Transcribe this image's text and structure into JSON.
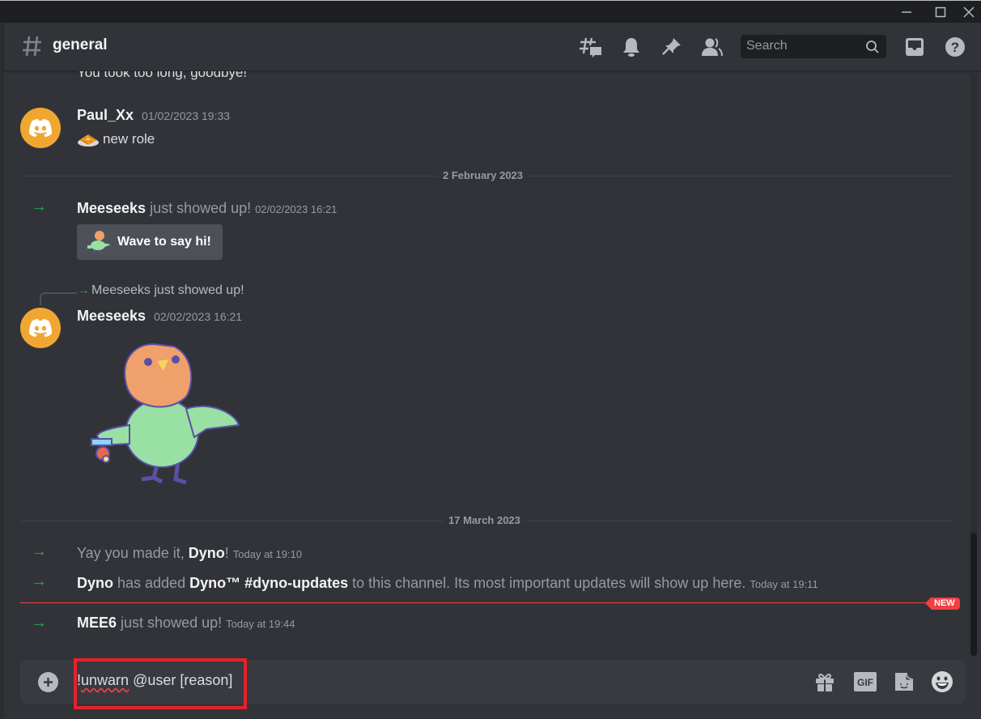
{
  "window": {
    "controls": [
      "minimize",
      "maximize",
      "close"
    ]
  },
  "header": {
    "channel_name": "general",
    "icons": [
      "threads-icon",
      "notification-bell-icon",
      "pinned-messages-icon",
      "member-list-icon",
      "inbox-icon",
      "help-icon"
    ],
    "search": {
      "placeholder": "Search"
    }
  },
  "messages": {
    "partial_top": "You took too long, goodbye!",
    "paul": {
      "username": "Paul_Xx",
      "timestamp": "01/02/2023 19:33",
      "text": "new role",
      "emoji": "waffle"
    },
    "divider_1": "2 February 2023",
    "meeseeks_join": {
      "username": "Meeseeks",
      "text": "just showed up!",
      "timestamp": "02/02/2023 16:21",
      "wave_button": "Wave to say hi!"
    },
    "meeseeks_reply": {
      "reply_preview": "Meeseeks just showed up!",
      "username": "Meeseeks",
      "timestamp": "02/02/2023 16:21",
      "sticker": "parrot-wave-sticker"
    },
    "divider_2": "17 March 2023",
    "dyno_welcome": {
      "prefix": "Yay you made it, ",
      "username": "Dyno",
      "suffix": "!",
      "timestamp": "Today at 19:10"
    },
    "dyno_follow": {
      "username": "Dyno",
      "text_1": " has added ",
      "channel": "Dyno™ #dyno-updates",
      "text_2": " to this channel. Its most important updates will show up here.",
      "timestamp": "Today at 19:11"
    },
    "new_badge": "NEW",
    "mee6_join": {
      "username": "MEE6",
      "text": "just showed up!",
      "timestamp": "Today at 19:44"
    }
  },
  "composer": {
    "value_prefix": "!",
    "value_misspelled": "unwarn",
    "value_rest": " @user [reason]",
    "icons": [
      "gift-icon",
      "gif-icon",
      "sticker-icon",
      "emoji-icon"
    ],
    "gif_label": "GIF"
  },
  "scrollbar": {
    "position_fraction": 0.79,
    "visible_fraction": 0.21
  }
}
